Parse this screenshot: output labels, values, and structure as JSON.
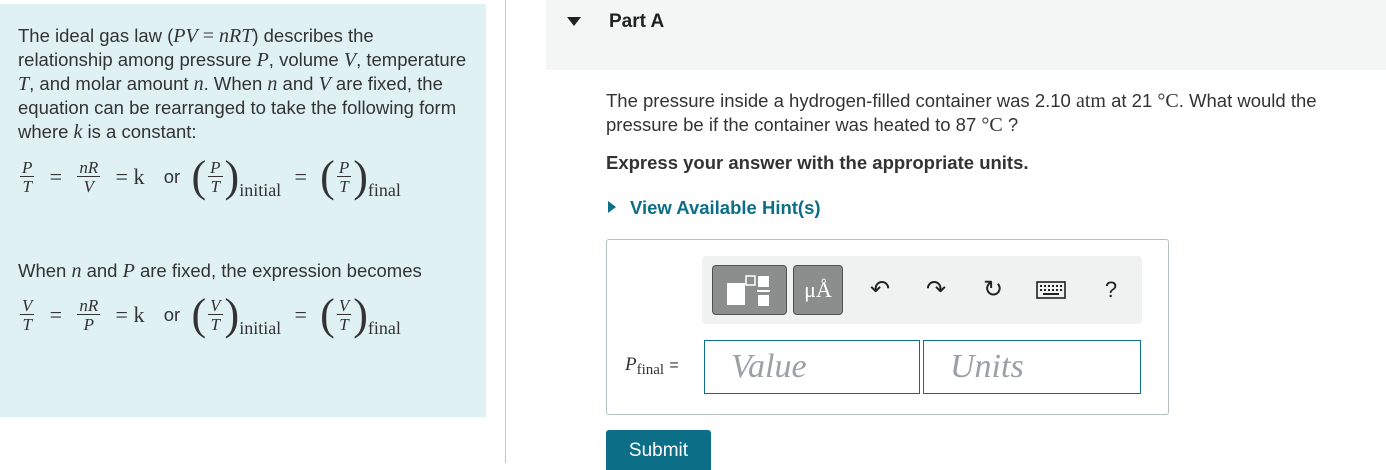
{
  "info_panel": {
    "intro": [
      {
        "t": "The ideal gas law ("
      },
      {
        "m": "PV"
      },
      {
        "r": " = "
      },
      {
        "m": "nRT"
      },
      {
        "t": ") describes the relationship among pressure "
      },
      {
        "m": "P"
      },
      {
        "t": ", volume "
      },
      {
        "m": "V"
      },
      {
        "t": ", temperature "
      },
      {
        "m": "T"
      },
      {
        "t": ", and molar amount "
      },
      {
        "m": "n"
      },
      {
        "t": ". When "
      },
      {
        "m": "n"
      },
      {
        "t": " and "
      },
      {
        "m": "V"
      },
      {
        "t": " are fixed, the equation can be rearranged to take the following form where "
      },
      {
        "m": "k"
      },
      {
        "t": " is a constant:"
      }
    ],
    "eq1": {
      "f1n": "P",
      "f1d": "T",
      "f2n": "nR",
      "f2d": "V",
      "k": "k",
      "or": "or",
      "pn": "P",
      "pd": "T",
      "initial": "initial",
      "final": "final",
      "eq": "=",
      "eq2": "= k"
    },
    "mid": [
      {
        "t": "When "
      },
      {
        "m": "n"
      },
      {
        "t": " and "
      },
      {
        "m": "P"
      },
      {
        "t": " are fixed, the expression becomes"
      }
    ],
    "eq2": {
      "f1n": "V",
      "f1d": "T",
      "f2n": "nR",
      "f2d": "P",
      "k": "k",
      "or": "or",
      "pn": "V",
      "pd": "T",
      "initial": "initial",
      "final": "final",
      "eq": "=",
      "eq2": "= k"
    }
  },
  "part": {
    "title": "Part A"
  },
  "question": [
    {
      "t": "The pressure inside a hydrogen-filled container was 2.10 "
    },
    {
      "r": "atm"
    },
    {
      "t": " at 21 "
    },
    {
      "r": "°C"
    },
    {
      "t": ". What would the pressure be if the container was heated to 87 "
    },
    {
      "r": "°C"
    },
    {
      "t": " ?"
    }
  ],
  "instruction": "Express your answer with the appropriate units.",
  "hint_link": "View Available Hint(s)",
  "toolbar": {
    "units_label": "μÅ",
    "undo": "↶",
    "redo": "↷",
    "reset": "↻",
    "help": "?"
  },
  "answer": {
    "variable": "P",
    "subscript": "final",
    "equals": "=",
    "value_placeholder": "Value",
    "units_placeholder": "Units"
  },
  "submit_label": "Submit",
  "colors": {
    "accent": "#0c6e87",
    "info_bg": "#dff1f3",
    "header_bg": "#f4f5f5"
  }
}
